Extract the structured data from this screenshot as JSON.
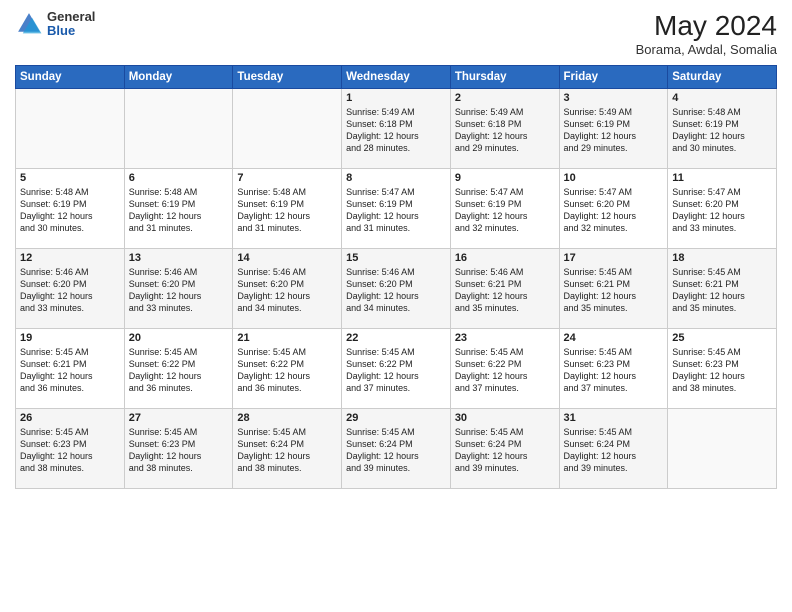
{
  "header": {
    "logo_general": "General",
    "logo_blue": "Blue",
    "month_year": "May 2024",
    "location": "Borama, Awdal, Somalia"
  },
  "days_of_week": [
    "Sunday",
    "Monday",
    "Tuesday",
    "Wednesday",
    "Thursday",
    "Friday",
    "Saturday"
  ],
  "weeks": [
    [
      {
        "day": "",
        "info": ""
      },
      {
        "day": "",
        "info": ""
      },
      {
        "day": "",
        "info": ""
      },
      {
        "day": "1",
        "info": "Sunrise: 5:49 AM\nSunset: 6:18 PM\nDaylight: 12 hours\nand 28 minutes."
      },
      {
        "day": "2",
        "info": "Sunrise: 5:49 AM\nSunset: 6:18 PM\nDaylight: 12 hours\nand 29 minutes."
      },
      {
        "day": "3",
        "info": "Sunrise: 5:49 AM\nSunset: 6:19 PM\nDaylight: 12 hours\nand 29 minutes."
      },
      {
        "day": "4",
        "info": "Sunrise: 5:48 AM\nSunset: 6:19 PM\nDaylight: 12 hours\nand 30 minutes."
      }
    ],
    [
      {
        "day": "5",
        "info": "Sunrise: 5:48 AM\nSunset: 6:19 PM\nDaylight: 12 hours\nand 30 minutes."
      },
      {
        "day": "6",
        "info": "Sunrise: 5:48 AM\nSunset: 6:19 PM\nDaylight: 12 hours\nand 31 minutes."
      },
      {
        "day": "7",
        "info": "Sunrise: 5:48 AM\nSunset: 6:19 PM\nDaylight: 12 hours\nand 31 minutes."
      },
      {
        "day": "8",
        "info": "Sunrise: 5:47 AM\nSunset: 6:19 PM\nDaylight: 12 hours\nand 31 minutes."
      },
      {
        "day": "9",
        "info": "Sunrise: 5:47 AM\nSunset: 6:19 PM\nDaylight: 12 hours\nand 32 minutes."
      },
      {
        "day": "10",
        "info": "Sunrise: 5:47 AM\nSunset: 6:20 PM\nDaylight: 12 hours\nand 32 minutes."
      },
      {
        "day": "11",
        "info": "Sunrise: 5:47 AM\nSunset: 6:20 PM\nDaylight: 12 hours\nand 33 minutes."
      }
    ],
    [
      {
        "day": "12",
        "info": "Sunrise: 5:46 AM\nSunset: 6:20 PM\nDaylight: 12 hours\nand 33 minutes."
      },
      {
        "day": "13",
        "info": "Sunrise: 5:46 AM\nSunset: 6:20 PM\nDaylight: 12 hours\nand 33 minutes."
      },
      {
        "day": "14",
        "info": "Sunrise: 5:46 AM\nSunset: 6:20 PM\nDaylight: 12 hours\nand 34 minutes."
      },
      {
        "day": "15",
        "info": "Sunrise: 5:46 AM\nSunset: 6:20 PM\nDaylight: 12 hours\nand 34 minutes."
      },
      {
        "day": "16",
        "info": "Sunrise: 5:46 AM\nSunset: 6:21 PM\nDaylight: 12 hours\nand 35 minutes."
      },
      {
        "day": "17",
        "info": "Sunrise: 5:45 AM\nSunset: 6:21 PM\nDaylight: 12 hours\nand 35 minutes."
      },
      {
        "day": "18",
        "info": "Sunrise: 5:45 AM\nSunset: 6:21 PM\nDaylight: 12 hours\nand 35 minutes."
      }
    ],
    [
      {
        "day": "19",
        "info": "Sunrise: 5:45 AM\nSunset: 6:21 PM\nDaylight: 12 hours\nand 36 minutes."
      },
      {
        "day": "20",
        "info": "Sunrise: 5:45 AM\nSunset: 6:22 PM\nDaylight: 12 hours\nand 36 minutes."
      },
      {
        "day": "21",
        "info": "Sunrise: 5:45 AM\nSunset: 6:22 PM\nDaylight: 12 hours\nand 36 minutes."
      },
      {
        "day": "22",
        "info": "Sunrise: 5:45 AM\nSunset: 6:22 PM\nDaylight: 12 hours\nand 37 minutes."
      },
      {
        "day": "23",
        "info": "Sunrise: 5:45 AM\nSunset: 6:22 PM\nDaylight: 12 hours\nand 37 minutes."
      },
      {
        "day": "24",
        "info": "Sunrise: 5:45 AM\nSunset: 6:23 PM\nDaylight: 12 hours\nand 37 minutes."
      },
      {
        "day": "25",
        "info": "Sunrise: 5:45 AM\nSunset: 6:23 PM\nDaylight: 12 hours\nand 38 minutes."
      }
    ],
    [
      {
        "day": "26",
        "info": "Sunrise: 5:45 AM\nSunset: 6:23 PM\nDaylight: 12 hours\nand 38 minutes."
      },
      {
        "day": "27",
        "info": "Sunrise: 5:45 AM\nSunset: 6:23 PM\nDaylight: 12 hours\nand 38 minutes."
      },
      {
        "day": "28",
        "info": "Sunrise: 5:45 AM\nSunset: 6:24 PM\nDaylight: 12 hours\nand 38 minutes."
      },
      {
        "day": "29",
        "info": "Sunrise: 5:45 AM\nSunset: 6:24 PM\nDaylight: 12 hours\nand 39 minutes."
      },
      {
        "day": "30",
        "info": "Sunrise: 5:45 AM\nSunset: 6:24 PM\nDaylight: 12 hours\nand 39 minutes."
      },
      {
        "day": "31",
        "info": "Sunrise: 5:45 AM\nSunset: 6:24 PM\nDaylight: 12 hours\nand 39 minutes."
      },
      {
        "day": "",
        "info": ""
      }
    ]
  ]
}
